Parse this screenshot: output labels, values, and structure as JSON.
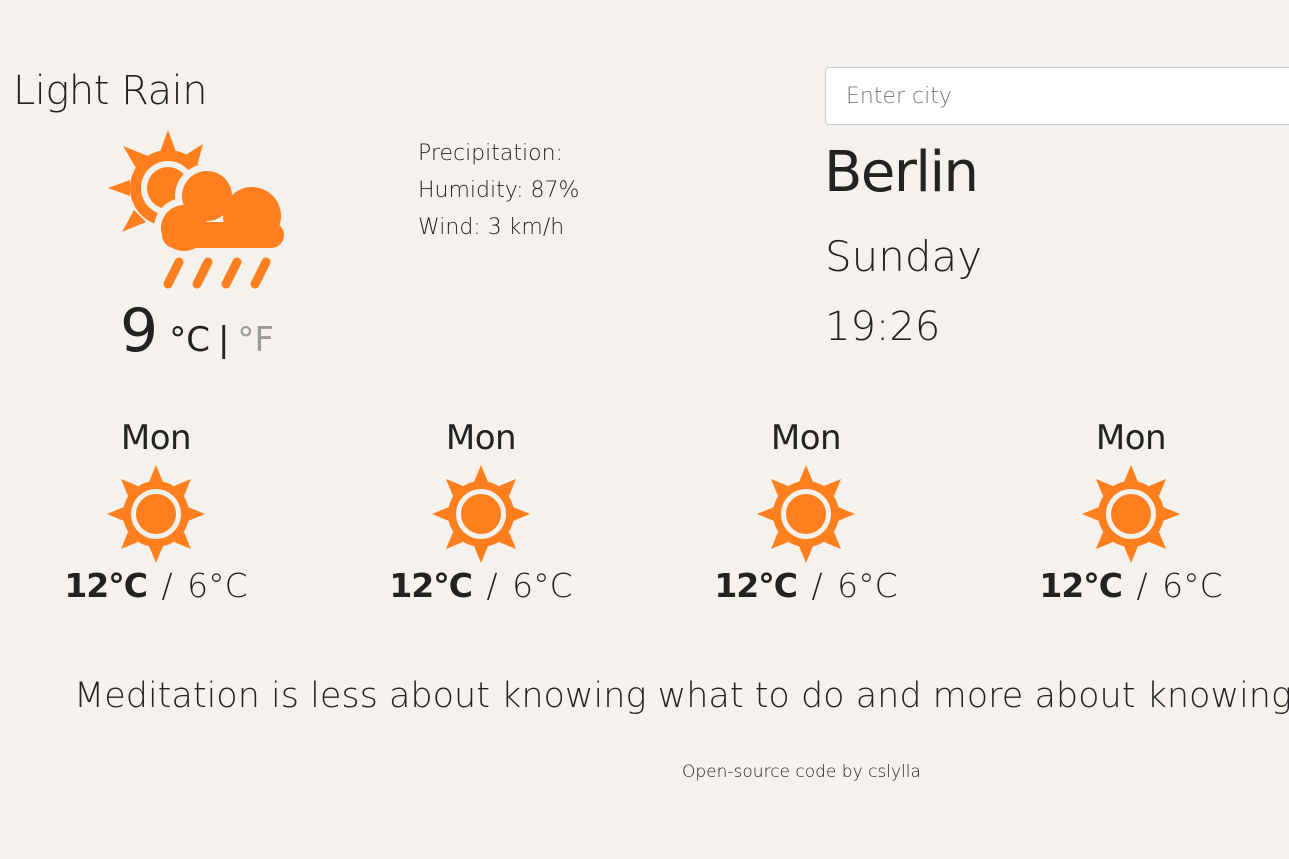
{
  "current": {
    "condition": "Light Rain",
    "icon": "sun-cloud-rain-icon",
    "temperature": "9",
    "unit_celsius": "°C",
    "unit_separator": "|",
    "unit_fahrenheit": "°F",
    "precipitation_label": "Precipitation:",
    "humidity_label": "Humidity: 87%",
    "wind_label": "Wind: 3 km/h"
  },
  "search": {
    "placeholder": "Enter city",
    "value": ""
  },
  "location": {
    "city": "Berlin",
    "day": "Sunday",
    "time": "19:26"
  },
  "forecast": [
    {
      "day": "Mon",
      "icon": "sun-icon",
      "high": "12°C",
      "separator": "/",
      "low": "6°C"
    },
    {
      "day": "Mon",
      "icon": "sun-icon",
      "high": "12°C",
      "separator": "/",
      "low": "6°C"
    },
    {
      "day": "Mon",
      "icon": "sun-icon",
      "high": "12°C",
      "separator": "/",
      "low": "6°C"
    },
    {
      "day": "Mon",
      "icon": "sun-icon",
      "high": "12°C",
      "separator": "/",
      "low": "6°C"
    }
  ],
  "quote": "Meditation is less about knowing what to do and more about knowing w",
  "footer": {
    "link_text": "Open-source code",
    "suffix": " by cslylla"
  },
  "colors": {
    "background": "#f5f1ec",
    "accent": "#ff7f1e",
    "text": "#222222",
    "muted": "#9a9a9a"
  }
}
